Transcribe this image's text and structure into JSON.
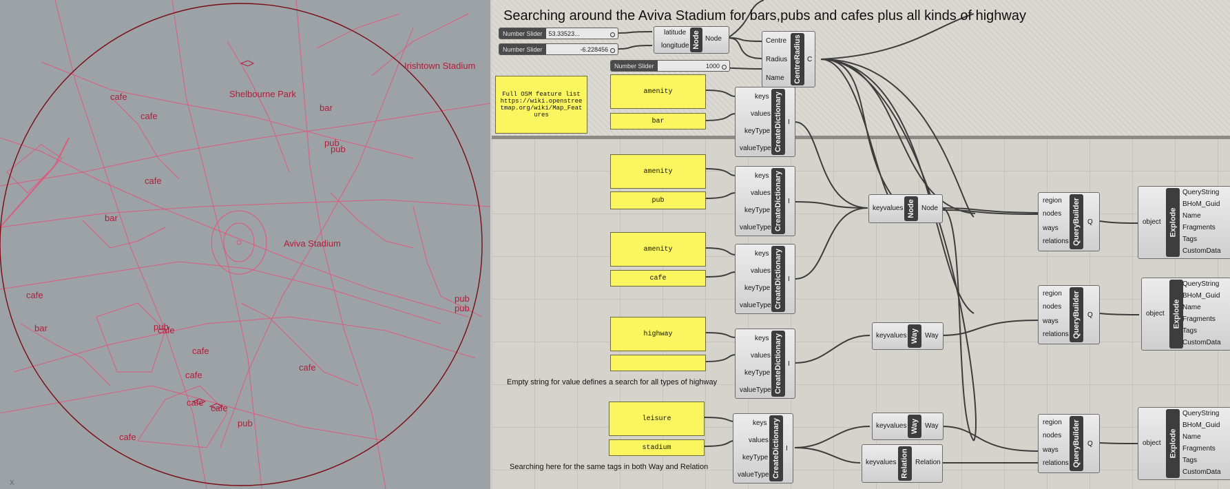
{
  "title": "Searching around the Aviva Stadium for bars,pubs and cafes plus all kinds of highway",
  "viewport": {
    "axis_label": "X",
    "labels": [
      "Irishtown Stadium",
      "Shelbourne Park",
      "cafe",
      "cafe",
      "bar",
      "pub",
      "pub",
      "cafe",
      "bar",
      "Aviva Stadium",
      "cafe",
      "bar",
      "pub",
      "cafe",
      "cafe",
      "cafe",
      "cafe",
      "cafe",
      "pub",
      "cafe",
      "pub",
      "pub",
      "cafe"
    ]
  },
  "sliders": [
    {
      "label": "Number Slider",
      "value": "53.33523..."
    },
    {
      "label": "Number Slider",
      "value": "-6.228456"
    },
    {
      "label": "Number Slider",
      "value": "1000"
    }
  ],
  "node_comp": {
    "name": "Node",
    "inputs": [
      "latitude",
      "longitude"
    ],
    "output": "Node"
  },
  "centre_comp": {
    "name": "CentreRadius",
    "inputs": [
      "Centre",
      "Radius",
      "Name"
    ],
    "output": "C"
  },
  "osm_panel": "Full OSM feature list https://wiki.openstreetmap.org/wiki/Map_Features",
  "panels": [
    "amenity",
    "bar",
    "amenity",
    "pub",
    "amenity",
    "cafe",
    "highway",
    "",
    "leisure",
    "stadium"
  ],
  "create_dict": {
    "name": "CreateDictionary",
    "inputs": [
      "keys",
      "values",
      "keyType",
      "valueType"
    ],
    "output": "I"
  },
  "keyval_node": {
    "input": "keyvalues",
    "name": "Node",
    "output": "Node"
  },
  "keyval_way": {
    "input": "keyvalues",
    "name": "Way",
    "output": "Way"
  },
  "keyval_relation": {
    "input": "keyvalues",
    "name": "Relation",
    "output": "Relation"
  },
  "query_builder": {
    "name": "QueryBuilder",
    "inputs": [
      "region",
      "nodes",
      "ways",
      "relations"
    ],
    "output": "Q"
  },
  "explode": {
    "name": "Explode",
    "input": "object",
    "outputs": [
      "QueryString",
      "BHoM_Guid",
      "Name",
      "Fragments",
      "Tags",
      "CustomData"
    ]
  },
  "notes": {
    "highway": "Empty string for value defines a search for all types of highway",
    "stadium": "Searching here for the same tags in both Way and Relation"
  },
  "colors": {
    "map_lines": "#e0567a",
    "map_circle": "#7a0a14",
    "panel": "#fbf55f",
    "component_core": "#3d3d3d"
  }
}
